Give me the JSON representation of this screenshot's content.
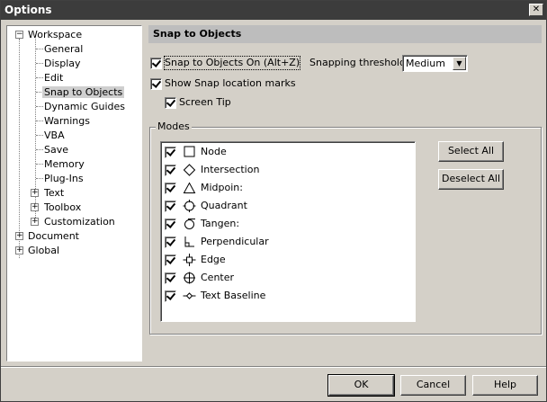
{
  "window": {
    "title": "Options",
    "close_glyph": "✕"
  },
  "tree": {
    "items": [
      {
        "label": "Workspace",
        "expander": "−"
      },
      {
        "label": "General"
      },
      {
        "label": "Display"
      },
      {
        "label": "Edit"
      },
      {
        "label": "Snap to Objects"
      },
      {
        "label": "Dynamic Guides"
      },
      {
        "label": "Warnings"
      },
      {
        "label": "VBA"
      },
      {
        "label": "Save"
      },
      {
        "label": "Memory"
      },
      {
        "label": "Plug-Ins"
      },
      {
        "label": "Text",
        "expander": "+"
      },
      {
        "label": "Toolbox",
        "expander": "+"
      },
      {
        "label": "Customization",
        "expander": "+"
      },
      {
        "label": "Document",
        "expander": "+"
      },
      {
        "label": "Global",
        "expander": "+"
      }
    ]
  },
  "panel": {
    "title": "Snap to Objects",
    "snap_on": {
      "label": "Snap to Objects On (Alt+Z)",
      "checked": true
    },
    "threshold_label": "Snapping threshold",
    "threshold_value": "Medium",
    "show_marks": {
      "label": "Show Snap location marks",
      "checked": true
    },
    "screen_tip": {
      "label": "Screen Tip",
      "checked": true
    },
    "modes_title": "Modes",
    "modes": [
      {
        "label": "Node",
        "icon": "square-icon",
        "checked": true
      },
      {
        "label": "Intersection",
        "icon": "diamond-icon",
        "checked": true
      },
      {
        "label": "Midpoin:",
        "icon": "triangle-icon",
        "checked": true
      },
      {
        "label": "Quadrant",
        "icon": "quadrant-icon",
        "checked": true
      },
      {
        "label": "Tangen:",
        "icon": "tangent-icon",
        "checked": true
      },
      {
        "label": "Perpendicular",
        "icon": "perpendicular-icon",
        "checked": true
      },
      {
        "label": "Edge",
        "icon": "edge-icon",
        "checked": true
      },
      {
        "label": "Center",
        "icon": "center-icon",
        "checked": true
      },
      {
        "label": "Text Baseline",
        "icon": "text-baseline-icon",
        "checked": true
      }
    ],
    "select_all": "Select All",
    "deselect_all": "Deselect All"
  },
  "footer": {
    "ok": "OK",
    "cancel": "Cancel",
    "help": "Help"
  }
}
